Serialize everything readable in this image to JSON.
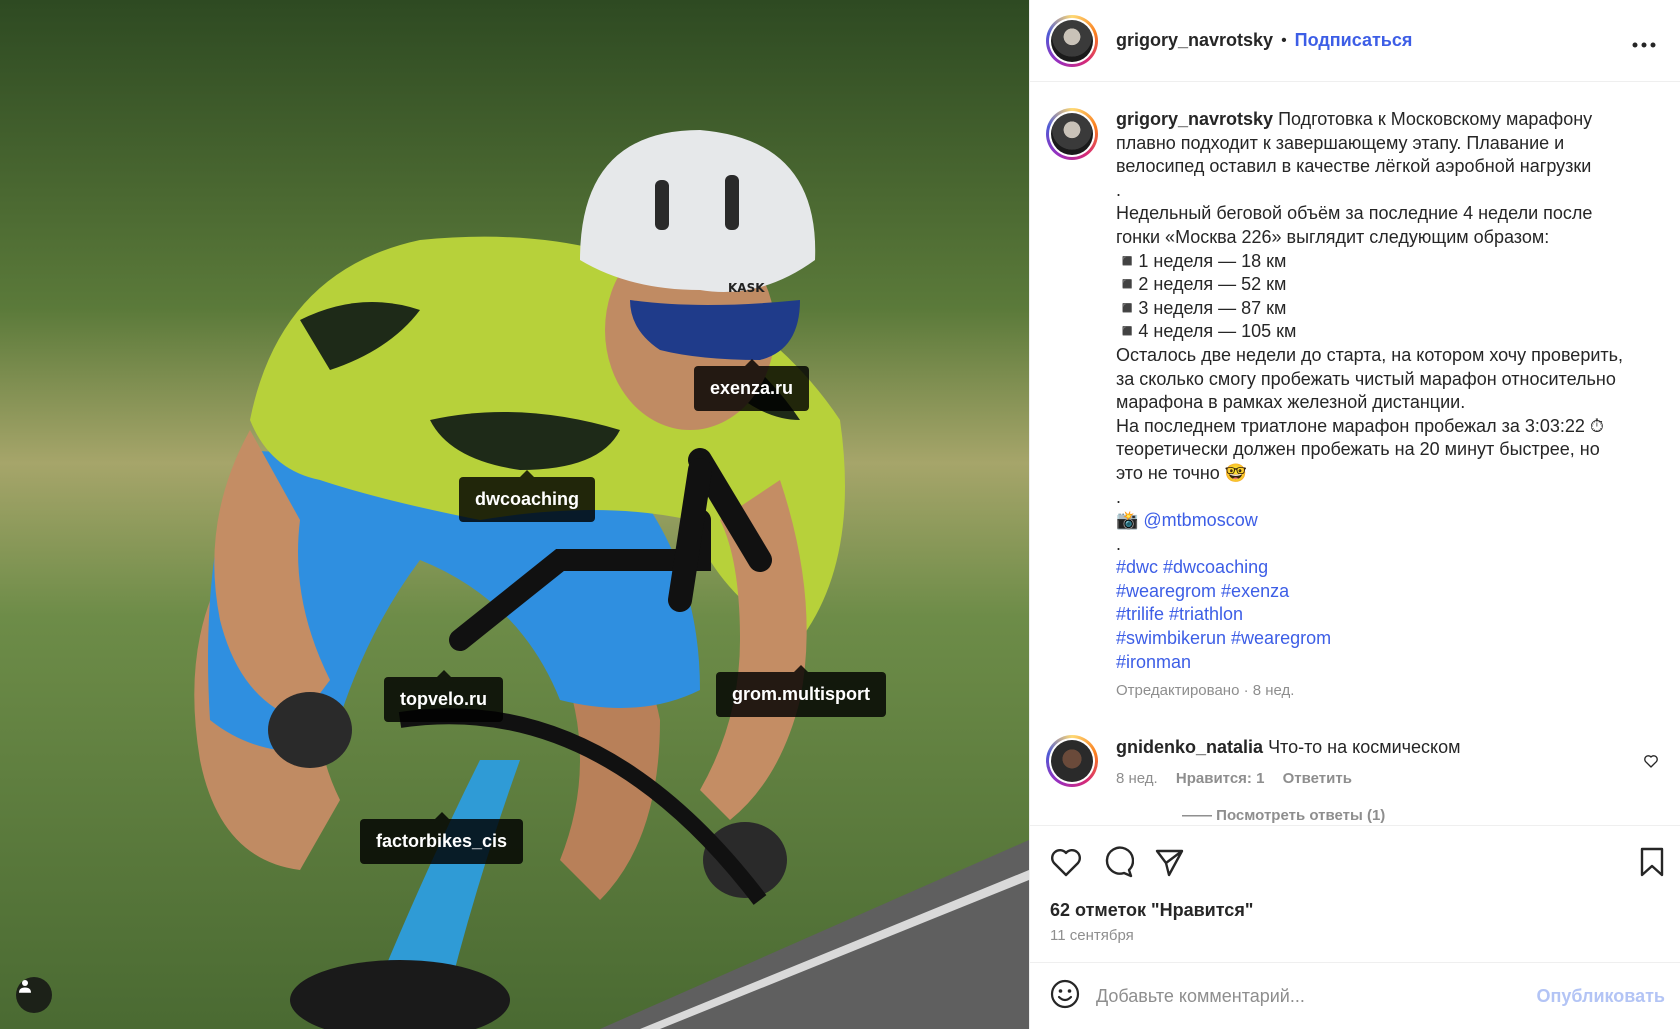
{
  "post": {
    "username": "grigory_navrotsky",
    "follow_label": "Подписаться",
    "separator": "•",
    "more_label": "•••"
  },
  "photo": {
    "tags": [
      "exenza.ru",
      "dwcoaching",
      "topvelo.ru",
      "grom.multisport",
      "factorbikes_cis"
    ],
    "helmet_brand": "KASK"
  },
  "caption": {
    "username": "grigory_navrotsky",
    "lines": [
      "Подготовка к Московскому марафону",
      "плавно подходит к завершающему этапу. Плавание и",
      "велосипед оставил в качестве лёгкой аэробной нагрузки",
      ".",
      "Недельный беговой объём за последние 4 недели после",
      "гонки «Москва 226» выглядит следующим образом:",
      "◾️1 неделя — 18 км",
      "◾️2 неделя — 52 км",
      "◾️3 неделя — 87 км",
      "◾️4 неделя — 105 км",
      "Осталось две недели до старта, на котором хочу проверить,",
      "за сколько смогу пробежать чистый марафон относительно",
      "марафона в рамках железной дистанции.",
      "На последнем триатлоне марафон пробежал за 3:03:22 ⏱",
      "теоретически должен пробежать на 20 минут быстрее, но",
      "это не точно 🤓",
      "."
    ],
    "mention": "📸 @mtbmoscow",
    "dot2": ".",
    "hashtag_lines": [
      "#dwc #dwcoaching",
      "#wearegrom #exenza",
      "#trilife #triathlon",
      "#swimbikerun #wearegrom",
      "#ironman"
    ],
    "meta": "Отредактировано · 8 нед."
  },
  "comment": {
    "username": "gnidenko_natalia",
    "text": "Что-то на космическом",
    "time": "8 нед.",
    "likes": "Нравится: 1",
    "reply": "Ответить",
    "view_replies": "—— Посмотреть ответы (1)"
  },
  "footer": {
    "likes": "62 отметок \"Нравится\"",
    "date": "11 сентября",
    "comment_placeholder": "Добавьте комментарий...",
    "publish_label": "Опубликовать"
  }
}
